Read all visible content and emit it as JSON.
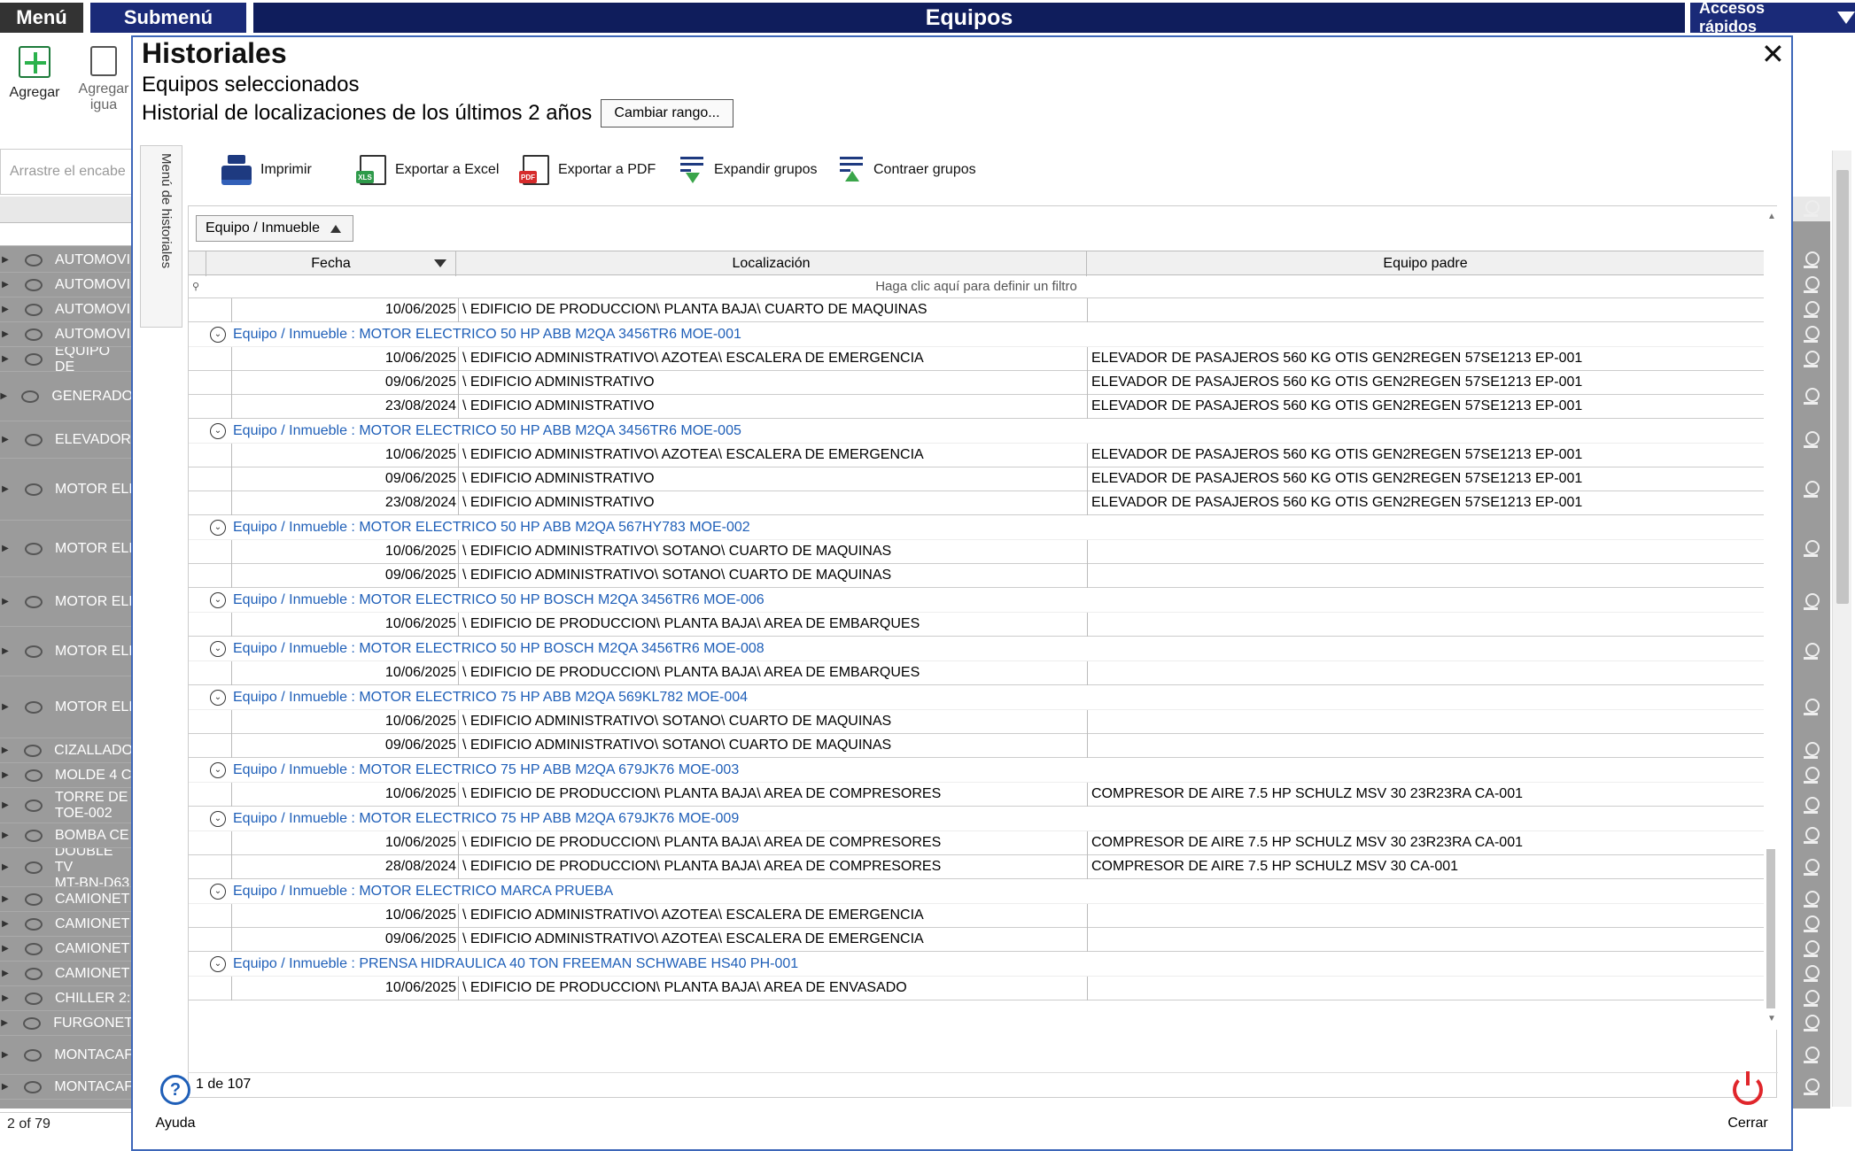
{
  "topbar": {
    "menu": "Menú",
    "submenu": "Submenú",
    "title": "Equipos",
    "quick_access": "Accesos rápidos"
  },
  "background": {
    "toolbar": {
      "add_label": "Agregar",
      "add_same_label": "Agregar\nigua"
    },
    "group_hint": "Arrastre el encabe",
    "rows": [
      "AUTOMOVI",
      "AUTOMOVI",
      "AUTOMOVI",
      "AUTOMOVI",
      "EQUIPO DE",
      "GENERADO",
      "ELEVADOR",
      "MOTOR ELI",
      "MOTOR ELI",
      "MOTOR ELI",
      "MOTOR ELI",
      "MOTOR ELI",
      "CIZALLADO",
      "MOLDE 4 C",
      "TORRE DE\nTOE-002",
      "BOMBA CE",
      "DOUBLE TV\nMT-BN-D63",
      "CAMIONET",
      "CAMIONET",
      "CAMIONET",
      "CAMIONET",
      "CHILLER 2:",
      "FURGONET",
      "MONTACAF",
      "MONTACAF"
    ],
    "status": "2 of 79"
  },
  "dialog": {
    "title": "Historiales",
    "close_label": "✕",
    "subtitle1": "Equipos seleccionados",
    "subtitle2": "Historial de localizaciones de los últimos 2 años",
    "change_range": "Cambiar rango...",
    "side_menu": "Menú de historiales",
    "toolbar": {
      "print": "Imprimir",
      "export_excel": "Exportar a Excel",
      "export_pdf": "Exportar a PDF",
      "expand": "Expandir grupos",
      "collapse": "Contraer grupos"
    },
    "group_chip": "Equipo / Inmueble",
    "columns": {
      "date": "Fecha",
      "location": "Localización",
      "parent": "Equipo padre"
    },
    "filter_hint": "Haga clic aquí para definir un filtro",
    "footer": "1 de 107",
    "help": "Ayuda",
    "close": "Cerrar",
    "rows": [
      {
        "type": "data",
        "date": "10/06/2025",
        "loc": "\\ EDIFICIO DE PRODUCCION\\ PLANTA BAJA\\ CUARTO DE MAQUINAS",
        "parent": ""
      },
      {
        "type": "group",
        "label": "Equipo / Inmueble : MOTOR ELECTRICO 50 HP ABB M2QA 3456TR6 MOE-001"
      },
      {
        "type": "data",
        "date": "10/06/2025",
        "loc": "\\ EDIFICIO ADMINISTRATIVO\\ AZOTEA\\ ESCALERA DE EMERGENCIA",
        "parent": "ELEVADOR DE PASAJEROS 560 KG OTIS GEN2REGEN 57SE1213 EP-001"
      },
      {
        "type": "data",
        "date": "09/06/2025",
        "loc": "\\ EDIFICIO ADMINISTRATIVO",
        "parent": "ELEVADOR DE PASAJEROS 560 KG OTIS GEN2REGEN 57SE1213 EP-001"
      },
      {
        "type": "data",
        "date": "23/08/2024",
        "loc": "\\ EDIFICIO ADMINISTRATIVO",
        "parent": "ELEVADOR DE PASAJEROS 560 KG OTIS GEN2REGEN 57SE1213 EP-001"
      },
      {
        "type": "group",
        "label": "Equipo / Inmueble : MOTOR ELECTRICO 50 HP ABB M2QA 3456TR6 MOE-005"
      },
      {
        "type": "data",
        "date": "10/06/2025",
        "loc": "\\ EDIFICIO ADMINISTRATIVO\\ AZOTEA\\ ESCALERA DE EMERGENCIA",
        "parent": "ELEVADOR DE PASAJEROS 560 KG OTIS GEN2REGEN 57SE1213 EP-001"
      },
      {
        "type": "data",
        "date": "09/06/2025",
        "loc": "\\ EDIFICIO ADMINISTRATIVO",
        "parent": "ELEVADOR DE PASAJEROS 560 KG OTIS GEN2REGEN 57SE1213 EP-001"
      },
      {
        "type": "data",
        "date": "23/08/2024",
        "loc": "\\ EDIFICIO ADMINISTRATIVO",
        "parent": "ELEVADOR DE PASAJEROS 560 KG OTIS GEN2REGEN 57SE1213 EP-001"
      },
      {
        "type": "group",
        "label": "Equipo / Inmueble : MOTOR ELECTRICO 50 HP ABB M2QA 567HY783 MOE-002"
      },
      {
        "type": "data",
        "date": "10/06/2025",
        "loc": "\\ EDIFICIO ADMINISTRATIVO\\ SOTANO\\ CUARTO DE MAQUINAS",
        "parent": ""
      },
      {
        "type": "data",
        "date": "09/06/2025",
        "loc": "\\ EDIFICIO ADMINISTRATIVO\\ SOTANO\\ CUARTO DE MAQUINAS",
        "parent": ""
      },
      {
        "type": "group",
        "label": "Equipo / Inmueble : MOTOR ELECTRICO 50 HP BOSCH M2QA 3456TR6 MOE-006"
      },
      {
        "type": "data",
        "date": "10/06/2025",
        "loc": "\\ EDIFICIO DE PRODUCCION\\ PLANTA BAJA\\ AREA DE EMBARQUES",
        "parent": ""
      },
      {
        "type": "group",
        "label": "Equipo / Inmueble : MOTOR ELECTRICO 50 HP BOSCH M2QA 3456TR6 MOE-008"
      },
      {
        "type": "data",
        "date": "10/06/2025",
        "loc": "\\ EDIFICIO DE PRODUCCION\\ PLANTA BAJA\\ AREA DE EMBARQUES",
        "parent": ""
      },
      {
        "type": "group",
        "label": "Equipo / Inmueble : MOTOR ELECTRICO 75 HP ABB M2QA 569KL782 MOE-004"
      },
      {
        "type": "data",
        "date": "10/06/2025",
        "loc": "\\ EDIFICIO ADMINISTRATIVO\\ SOTANO\\ CUARTO DE MAQUINAS",
        "parent": ""
      },
      {
        "type": "data",
        "date": "09/06/2025",
        "loc": "\\ EDIFICIO ADMINISTRATIVO\\ SOTANO\\ CUARTO DE MAQUINAS",
        "parent": ""
      },
      {
        "type": "group",
        "label": "Equipo / Inmueble : MOTOR ELECTRICO 75 HP ABB M2QA 679JK76 MOE-003"
      },
      {
        "type": "data",
        "date": "10/06/2025",
        "loc": "\\ EDIFICIO DE PRODUCCION\\ PLANTA BAJA\\ AREA DE COMPRESORES",
        "parent": "COMPRESOR DE AIRE 7.5 HP SCHULZ MSV 30 23R23RA CA-001"
      },
      {
        "type": "group",
        "label": "Equipo / Inmueble : MOTOR ELECTRICO 75 HP ABB M2QA 679JK76 MOE-009"
      },
      {
        "type": "data",
        "date": "10/06/2025",
        "loc": "\\ EDIFICIO DE PRODUCCION\\ PLANTA BAJA\\ AREA DE COMPRESORES",
        "parent": "COMPRESOR DE AIRE 7.5 HP SCHULZ MSV 30 23R23RA CA-001"
      },
      {
        "type": "data",
        "date": "28/08/2024",
        "loc": "\\ EDIFICIO DE PRODUCCION\\ PLANTA BAJA\\ AREA DE COMPRESORES",
        "parent": "COMPRESOR DE AIRE 7.5 HP SCHULZ MSV 30 CA-001"
      },
      {
        "type": "group",
        "label": "Equipo / Inmueble : MOTOR ELECTRICO MARCA PRUEBA"
      },
      {
        "type": "data",
        "date": "10/06/2025",
        "loc": "\\ EDIFICIO ADMINISTRATIVO\\ AZOTEA\\ ESCALERA DE EMERGENCIA",
        "parent": ""
      },
      {
        "type": "data",
        "date": "09/06/2025",
        "loc": "\\ EDIFICIO ADMINISTRATIVO\\ AZOTEA\\ ESCALERA DE EMERGENCIA",
        "parent": ""
      },
      {
        "type": "group",
        "label": "Equipo / Inmueble : PRENSA HIDRAULICA 40 TON FREEMAN SCHWABE HS40 PH-001"
      },
      {
        "type": "data",
        "date": "10/06/2025",
        "loc": "\\ EDIFICIO DE PRODUCCION\\ PLANTA BAJA\\ AREA DE ENVASADO",
        "parent": ""
      }
    ]
  }
}
